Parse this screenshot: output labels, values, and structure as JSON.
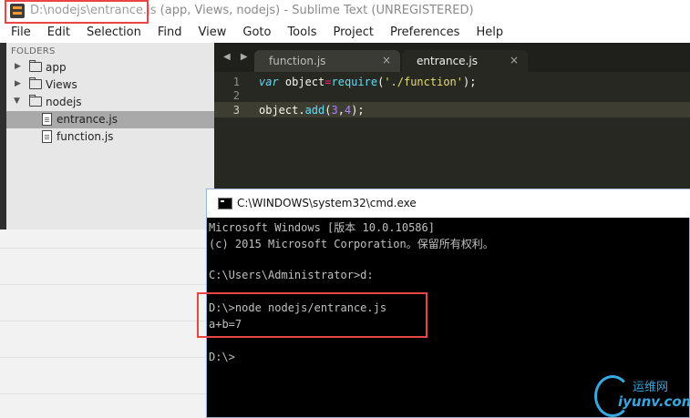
{
  "window": {
    "title_path": "D:\\nodejs\\entrance.js",
    "title_rest": " (app, Views, nodejs) - Sublime Text (UNREGISTERED)"
  },
  "menu": [
    "File",
    "Edit",
    "Selection",
    "Find",
    "View",
    "Goto",
    "Tools",
    "Project",
    "Preferences",
    "Help"
  ],
  "sidebar": {
    "header": "FOLDERS",
    "items": [
      {
        "label": "app",
        "type": "folder",
        "expanded": false
      },
      {
        "label": "Views",
        "type": "folder",
        "expanded": false
      },
      {
        "label": "nodejs",
        "type": "folder",
        "expanded": true
      },
      {
        "label": "entrance.js",
        "type": "file",
        "selected": true
      },
      {
        "label": "function.js",
        "type": "file",
        "selected": false
      }
    ]
  },
  "editor": {
    "nav": "◀ ▶",
    "tabs": [
      {
        "label": "function.js",
        "close": "×",
        "active": false
      },
      {
        "label": "entrance.js",
        "close": "×",
        "active": true
      }
    ],
    "line_numbers": [
      "1",
      "2",
      "3"
    ],
    "code": {
      "line1": {
        "kw": "var",
        "name": " object",
        "eq": "=",
        "call": "require",
        "open": "(",
        "str": "'./function'",
        "close": ");"
      },
      "line3": {
        "obj": "object.",
        "method": "add",
        "open": "(",
        "a": "3",
        "comma": ",",
        "b": "4",
        "close": ");"
      }
    }
  },
  "cmd": {
    "title": "C:\\WINDOWS\\system32\\cmd.exe",
    "lines": [
      "Microsoft Windows [版本 10.0.10586]",
      "(c) 2015 Microsoft Corporation。保留所有权利。",
      "",
      "C:\\Users\\Administrator>d:",
      "",
      "D:\\>node nodejs/entrance.js",
      "a+b=7",
      "",
      "D:\\>"
    ]
  },
  "watermark": {
    "cn": "运维网",
    "en": "iyunv.com"
  },
  "colors": {
    "highlight": "#e84545",
    "editor_bg": "#272822",
    "accent_blue": "#3aa4dc"
  }
}
